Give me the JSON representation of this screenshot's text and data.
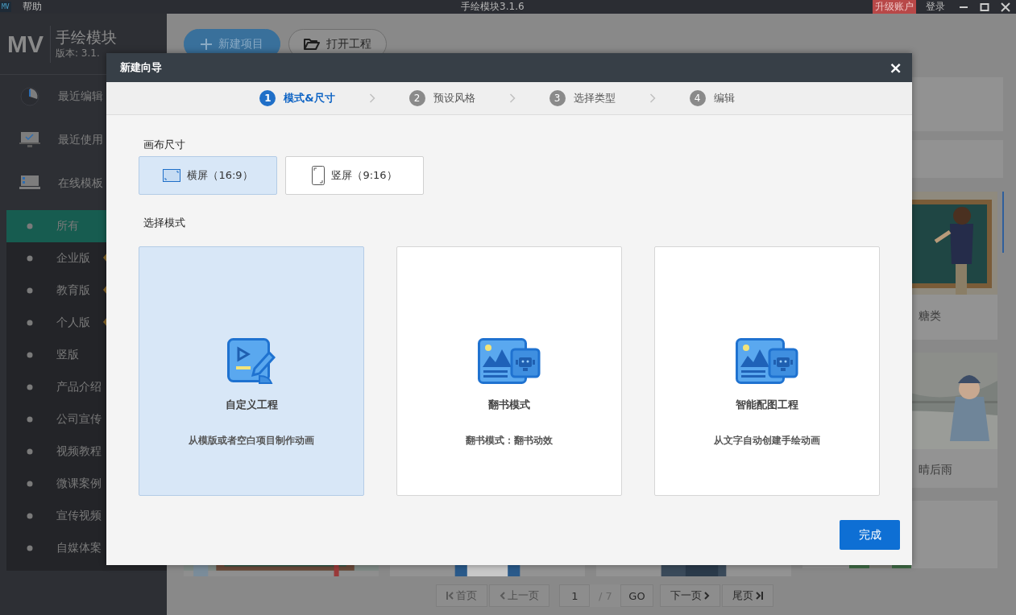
{
  "titlebar": {
    "app_icon": "MV",
    "menu": [
      "帮助"
    ],
    "title": "手绘模块3.1.6",
    "upgrade": "升级账户",
    "login": "登录"
  },
  "sidebar": {
    "logo": "MV",
    "app_name": "手绘模块",
    "version": "版本: 3.1.",
    "nav": [
      {
        "label": "最近编辑",
        "kind": "clock"
      },
      {
        "label": "最近使用",
        "kind": "monitor"
      },
      {
        "label": "在线模板",
        "kind": "template"
      }
    ],
    "categories": [
      {
        "label": "所有",
        "selected": true,
        "premium": false
      },
      {
        "label": "企业版",
        "selected": false,
        "premium": true
      },
      {
        "label": "教育版",
        "selected": false,
        "premium": true
      },
      {
        "label": "个人版",
        "selected": false,
        "premium": true
      },
      {
        "label": "竖版",
        "selected": false,
        "premium": false
      },
      {
        "label": "产品介绍",
        "selected": false,
        "premium": false
      },
      {
        "label": "公司宣传",
        "selected": false,
        "premium": false
      },
      {
        "label": "视频教程",
        "selected": false,
        "premium": false
      },
      {
        "label": "微课案例",
        "selected": false,
        "premium": false
      },
      {
        "label": "宣传视频",
        "selected": false,
        "premium": false
      },
      {
        "label": "自媒体案",
        "selected": false,
        "premium": false
      }
    ]
  },
  "toolbar": {
    "buttons": [
      {
        "label": "新建项目",
        "kind": "primary"
      },
      {
        "label": "打开工程",
        "kind": "open"
      }
    ]
  },
  "templates": [
    {
      "label": "糖类"
    },
    {
      "label": "晴后雨"
    }
  ],
  "pagination": {
    "first": "首页",
    "prev": "上一页",
    "page": "1",
    "total": "/ 7",
    "go": "GO",
    "next": "下一页",
    "last": "尾页"
  },
  "dialog": {
    "title": "新建向导",
    "close": "×",
    "steps": [
      {
        "number": "1",
        "label": "模式&尺寸",
        "selected": true
      },
      {
        "number": "2",
        "label": "预设风格",
        "selected": false
      },
      {
        "number": "3",
        "label": "选择类型",
        "selected": false
      },
      {
        "number": "4",
        "label": "编辑",
        "selected": false
      }
    ],
    "canvas_heading": "画布尺寸",
    "canvas_options": [
      {
        "label": "横屏（16:9）",
        "kind": "landscape",
        "selected": true
      },
      {
        "label": "竖屏（9:16）",
        "kind": "portrait",
        "selected": false
      }
    ],
    "mode_heading": "选择模式",
    "modes": [
      {
        "title": "自定义工程",
        "description": "从模版或者空白项目制作动画",
        "kind": "custom",
        "selected": true
      },
      {
        "title": "翻书模式",
        "description": "翻书模式：翻书动效",
        "kind": "book",
        "selected": false
      },
      {
        "title": "智能配图工程",
        "description": "从文字自动创建手绘动画",
        "kind": "smart",
        "selected": false
      }
    ],
    "finish": "完成"
  }
}
